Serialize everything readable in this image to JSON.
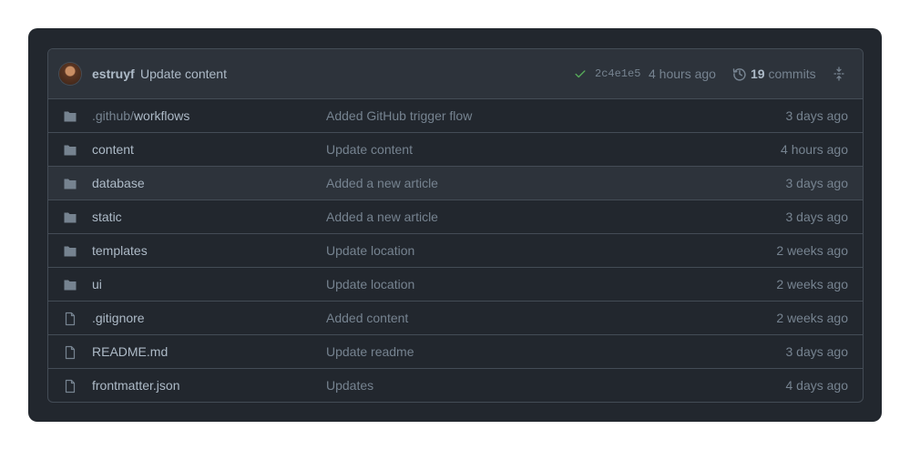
{
  "header": {
    "author": "estruyf",
    "message": "Update content",
    "sha": "2c4e1e5",
    "ago": "4 hours ago",
    "commit_count": "19",
    "commits_label": "commits"
  },
  "colors": {
    "background": "#22272e",
    "header_bg": "#2d333b",
    "border": "#444c56",
    "text": "#adbac7",
    "muted": "#768390",
    "success": "#57ab5a"
  },
  "files": [
    {
      "type": "folder",
      "prefix": ".github/",
      "name": "workflows",
      "message": "Added GitHub trigger flow",
      "date": "3 days ago"
    },
    {
      "type": "folder",
      "prefix": "",
      "name": "content",
      "message": "Update content",
      "date": "4 hours ago"
    },
    {
      "type": "folder",
      "prefix": "",
      "name": "database",
      "message": "Added a new article",
      "date": "3 days ago"
    },
    {
      "type": "folder",
      "prefix": "",
      "name": "static",
      "message": "Added a new article",
      "date": "3 days ago"
    },
    {
      "type": "folder",
      "prefix": "",
      "name": "templates",
      "message": "Update location",
      "date": "2 weeks ago"
    },
    {
      "type": "folder",
      "prefix": "",
      "name": "ui",
      "message": "Update location",
      "date": "2 weeks ago"
    },
    {
      "type": "file",
      "prefix": "",
      "name": ".gitignore",
      "message": "Added content",
      "date": "2 weeks ago"
    },
    {
      "type": "file",
      "prefix": "",
      "name": "README.md",
      "message": "Update readme",
      "date": "3 days ago"
    },
    {
      "type": "file",
      "prefix": "",
      "name": "frontmatter.json",
      "message": "Updates",
      "date": "4 days ago"
    }
  ]
}
